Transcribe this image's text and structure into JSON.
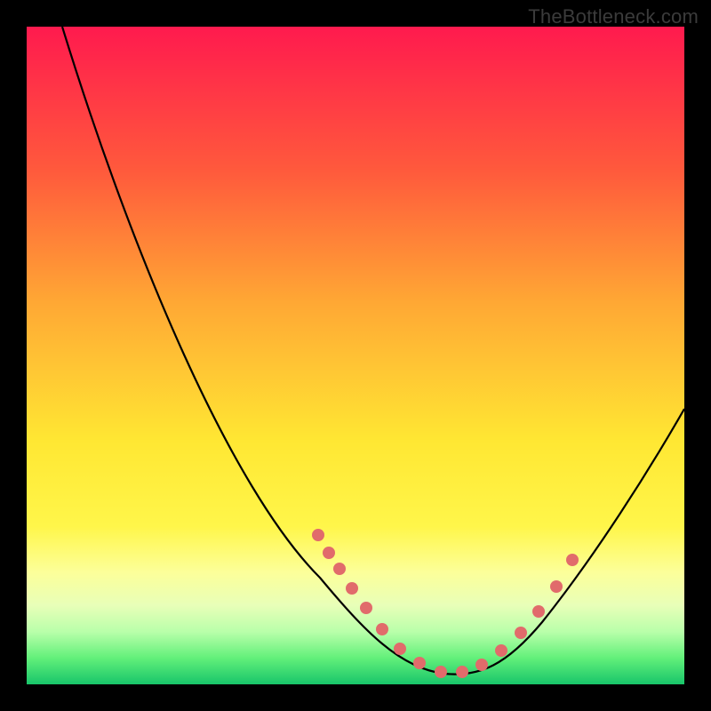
{
  "watermark": {
    "text": "TheBottleneck.com"
  },
  "chart_data": {
    "type": "line",
    "title": "",
    "xlabel": "",
    "ylabel": "",
    "xlim": [
      0,
      100
    ],
    "ylim": [
      0,
      100
    ],
    "series": [
      {
        "name": "bottleneck-curve",
        "x": [
          0,
          5,
          10,
          15,
          20,
          25,
          30,
          35,
          40,
          45,
          50,
          55,
          58,
          61,
          64,
          67,
          70,
          74,
          78,
          82,
          86,
          90,
          94,
          98,
          100
        ],
        "y": [
          100,
          93,
          85,
          77,
          68,
          59,
          50,
          41,
          33,
          25,
          18,
          11,
          8,
          5,
          3,
          2,
          2,
          3,
          6,
          11,
          17,
          24,
          31,
          38,
          42
        ]
      }
    ],
    "markers": {
      "name": "highlight-dots",
      "color": "#e16b6b",
      "x": [
        45,
        47,
        49,
        51,
        56,
        59,
        62,
        65,
        68,
        70,
        73,
        76,
        79,
        82,
        84
      ],
      "y": [
        25,
        22,
        19,
        16,
        10,
        7,
        5,
        3.5,
        2.5,
        2,
        3,
        5,
        8,
        12,
        16
      ]
    }
  }
}
